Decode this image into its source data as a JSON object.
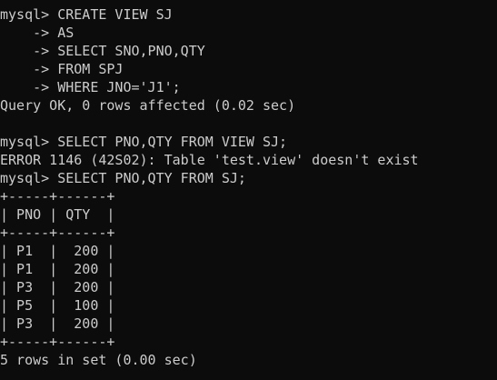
{
  "terminal": {
    "background": "#0c0c0c",
    "foreground": "#cccccc",
    "lines": [
      "mysql> CREATE VIEW SJ",
      "    -> AS",
      "    -> SELECT SNO,PNO,QTY",
      "    -> FROM SPJ",
      "    -> WHERE JNO='J1';",
      "Query OK, 0 rows affected (0.02 sec)",
      "",
      "mysql> SELECT PNO,QTY FROM VIEW SJ;",
      "ERROR 1146 (42S02): Table 'test.view' doesn't exist",
      "mysql> SELECT PNO,QTY FROM SJ;",
      "+-----+------+",
      "| PNO | QTY  |",
      "+-----+------+",
      "| P1  |  200 |",
      "| P1  |  200 |",
      "| P3  |  200 |",
      "| P5  |  100 |",
      "| P3  |  200 |",
      "+-----+------+",
      "5 rows in set (0.00 sec)"
    ]
  }
}
